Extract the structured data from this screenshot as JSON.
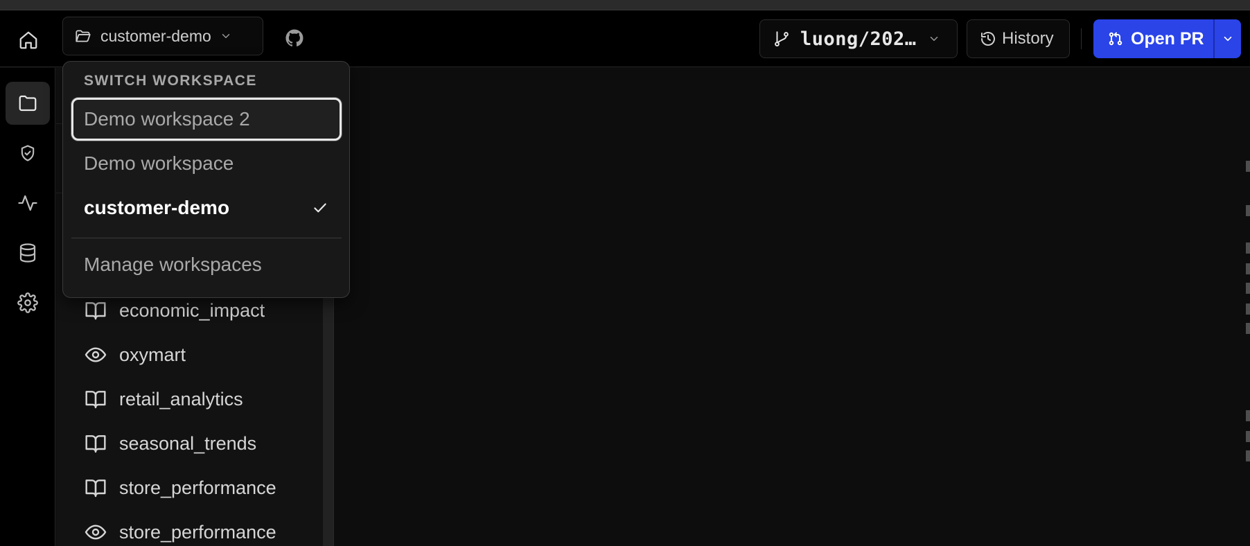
{
  "topbar": {
    "workspace_button": {
      "label": "customer-demo",
      "icon": "folder-open-icon"
    },
    "branch_button": {
      "label": "luong/202…",
      "icon": "git-branch-icon"
    },
    "history_button": {
      "label": "History",
      "icon": "history-icon"
    },
    "open_pr_button": {
      "label": "Open PR",
      "icon": "git-pull-request-icon"
    }
  },
  "left_rail": {
    "items": [
      {
        "name": "files",
        "icon": "folder-icon",
        "active": true
      },
      {
        "name": "verified",
        "icon": "shield-check-icon",
        "active": false
      },
      {
        "name": "activity",
        "icon": "activity-icon",
        "active": false
      },
      {
        "name": "database",
        "icon": "database-icon",
        "active": false
      },
      {
        "name": "settings",
        "icon": "gear-icon",
        "active": false
      }
    ]
  },
  "file_list": {
    "items": [
      {
        "label": "economic_impact",
        "icon": "book-open-icon"
      },
      {
        "label": "oxymart",
        "icon": "eye-icon"
      },
      {
        "label": "retail_analytics",
        "icon": "book-open-icon"
      },
      {
        "label": "seasonal_trends",
        "icon": "book-open-icon"
      },
      {
        "label": "store_performance",
        "icon": "book-open-icon"
      },
      {
        "label": "store_performance",
        "icon": "eye-icon"
      }
    ]
  },
  "workspace_menu": {
    "heading": "SWITCH WORKSPACE",
    "items": [
      {
        "label": "Demo workspace 2",
        "focused": true,
        "selected": false
      },
      {
        "label": "Demo workspace",
        "focused": false,
        "selected": false
      },
      {
        "label": "customer-demo",
        "focused": false,
        "selected": true
      }
    ],
    "manage_label": "Manage workspaces"
  },
  "colors": {
    "accent": "#2a44e8",
    "background": "#0d0d0d",
    "topbar": "#000000",
    "menu_bg": "#181818"
  }
}
